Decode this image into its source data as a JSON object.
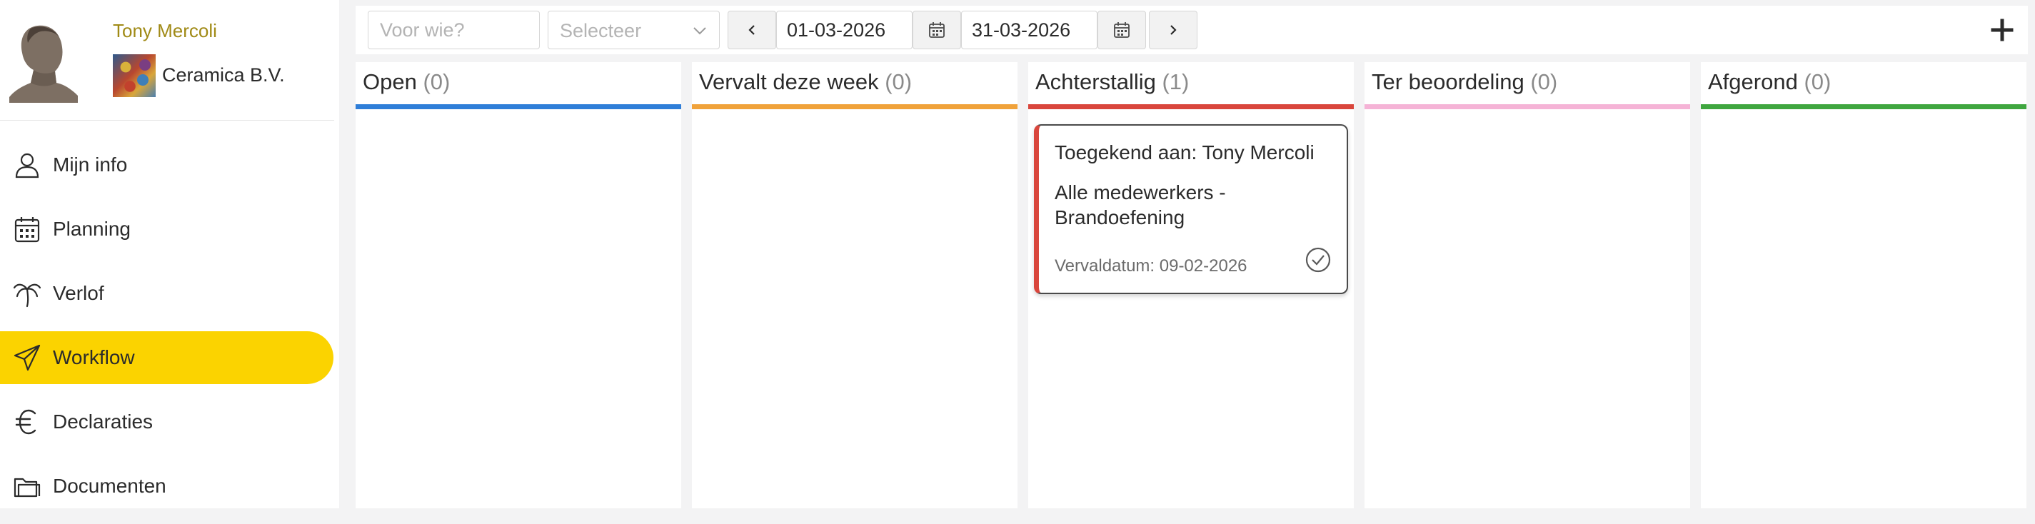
{
  "user": {
    "name": "Tony Mercoli",
    "company": "Ceramica B.V."
  },
  "nav": [
    {
      "label": "Mijn info",
      "icon": "user-icon",
      "active": false
    },
    {
      "label": "Planning",
      "icon": "calendar-icon",
      "active": false
    },
    {
      "label": "Verlof",
      "icon": "palm-tree-icon",
      "active": false
    },
    {
      "label": "Workflow",
      "icon": "paper-plane-icon",
      "active": true
    },
    {
      "label": "Declaraties",
      "icon": "euro-icon",
      "active": false
    },
    {
      "label": "Documenten",
      "icon": "folder-icon",
      "active": false
    }
  ],
  "toolbar": {
    "who_placeholder": "Voor wie?",
    "select_placeholder": "Selecteer",
    "date_from": "01-03-2026",
    "date_to": "31-03-2026",
    "prev_icon": "chevron-left-icon",
    "next_icon": "chevron-right-icon",
    "add_icon": "plus-icon"
  },
  "columns": [
    {
      "title": "Open",
      "count": "(0)",
      "color": "#2f7ed8"
    },
    {
      "title": "Vervalt deze week",
      "count": "(0)",
      "color": "#f0a23a"
    },
    {
      "title": "Achterstallig",
      "count": "(1)",
      "color": "#d9463c"
    },
    {
      "title": "Ter beoordeling",
      "count": "(0)",
      "color": "#f5b3d6"
    },
    {
      "title": "Afgerond",
      "count": "(0)",
      "color": "#3fa63f"
    }
  ],
  "card": {
    "assignee": "Toegekend aan: Tony Mercoli",
    "title": "Alle medewerkers - Brandoefening",
    "due": "Vervaldatum: 09-02-2026",
    "status_icon": "check-circle-icon"
  },
  "colors": {
    "accent": "#fbd300",
    "user_name": "#a08a16"
  }
}
